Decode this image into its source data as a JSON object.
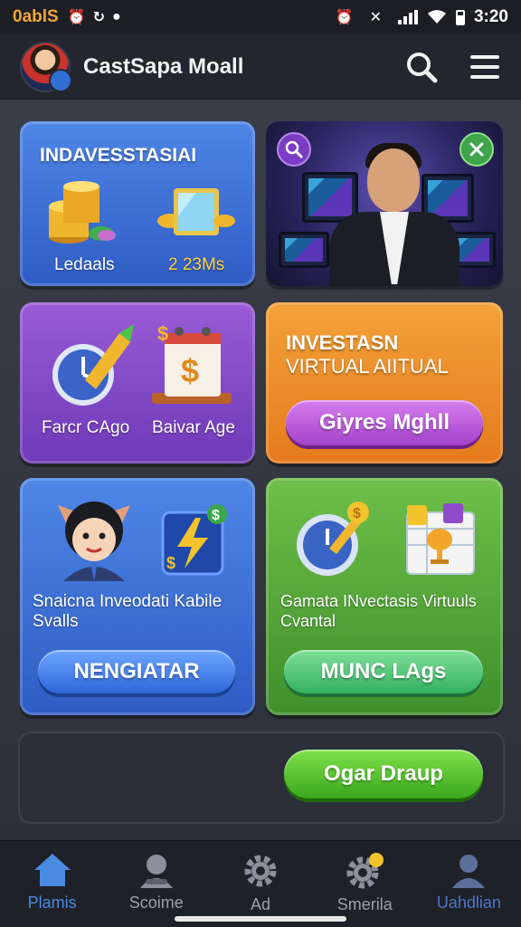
{
  "status_bar": {
    "carrier": "0ablS",
    "time": "3:20"
  },
  "header": {
    "title": "CastSapa Moall"
  },
  "cards": {
    "card1": {
      "title": "INDAVESSTASIAI",
      "caption_left": "Ledaals",
      "caption_right": "2 23Ms"
    },
    "card3": {
      "caption_left": "Farcr CAgo",
      "caption_right": "Baivar Age"
    },
    "card4": {
      "title_line1": "INVESTASN",
      "title_line2": "VIRTUAL AIITUAL",
      "button": "Giyres Mghll"
    },
    "card5": {
      "text_line1": "Snaicna Inveodati Kabile",
      "text_line2": "Svalls",
      "button": "NENGIATAR"
    },
    "card6": {
      "text_line1": "Gamata INvectasis Virtuuls",
      "text_line2": "Cvantal",
      "button": "MUNC LAgs"
    },
    "footer_card": {
      "button": "Ogar Draup"
    }
  },
  "bottom_nav": [
    {
      "label": "Plamis",
      "icon": "home-icon"
    },
    {
      "label": "Scoime",
      "icon": "person-icon"
    },
    {
      "label": "Ad",
      "icon": "gear-icon"
    },
    {
      "label": "Smerila",
      "icon": "gear-badge-icon"
    },
    {
      "label": "Uahdlian",
      "icon": "account-icon"
    }
  ],
  "colors": {
    "accent_blue": "#4a8ae0",
    "carrier_orange": "#f0a63a",
    "card_blue": "#3f74d8",
    "card_purple": "#8a4ccc",
    "card_orange": "#ee8f2a",
    "card_green": "#56a83a"
  }
}
